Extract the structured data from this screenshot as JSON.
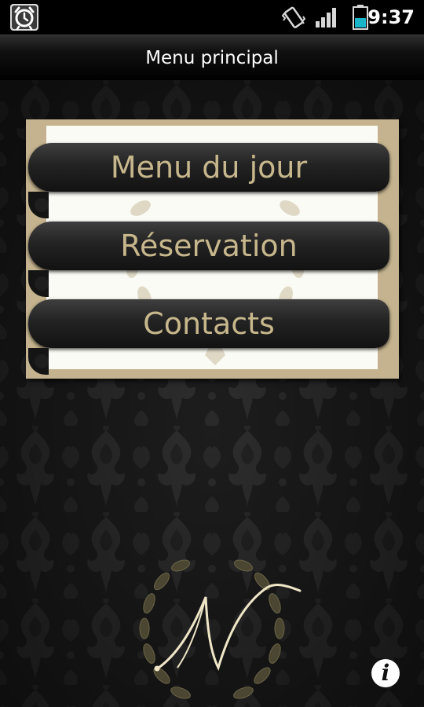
{
  "status_bar": {
    "time": "9:37",
    "icons": [
      "alarm-clock-icon",
      "vibrate-icon",
      "signal-icon",
      "battery-icon"
    ],
    "battery_color": "#19b5c8"
  },
  "title_bar": {
    "title": "Menu principal"
  },
  "menu": {
    "items": [
      {
        "label": "Menu du jour"
      },
      {
        "label": "Réservation"
      },
      {
        "label": "Contacts"
      }
    ],
    "label_color": "#c7b78c",
    "card_color": "#c4b38e"
  },
  "footer": {
    "logo_letter": "N",
    "info_icon": "info-icon"
  }
}
